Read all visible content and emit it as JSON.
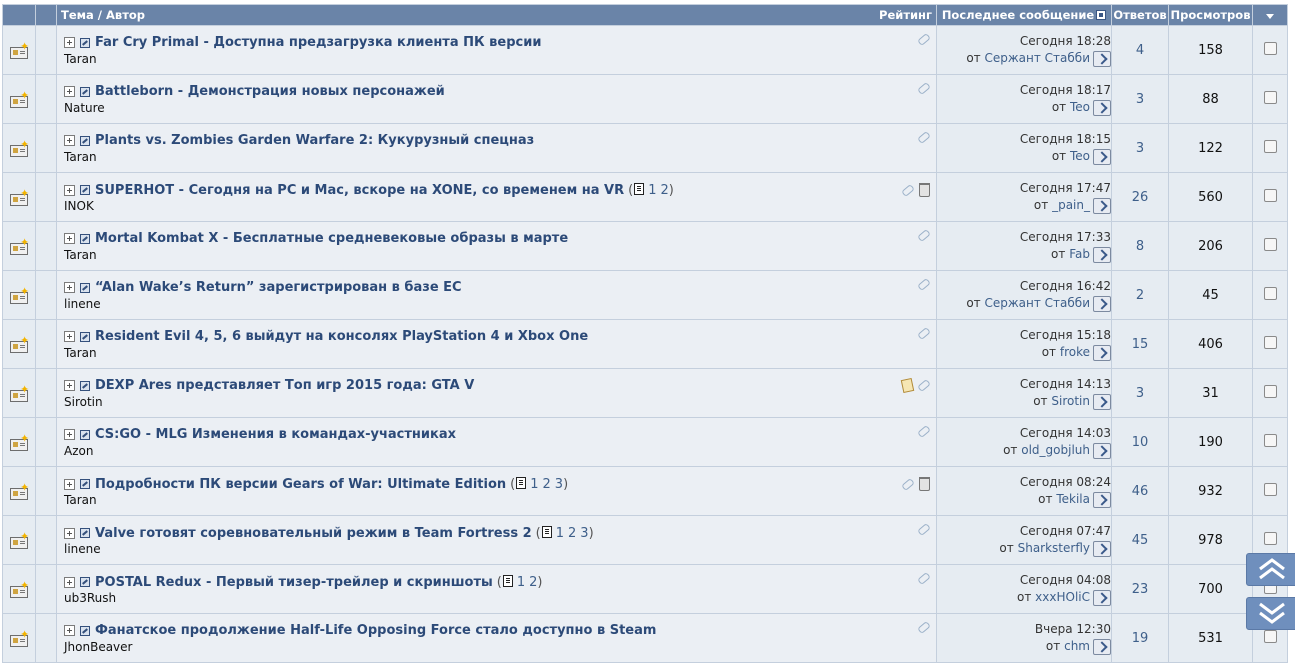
{
  "header": {
    "title_author": "Тема / Автор",
    "rating": "Рейтинг",
    "last_post": "Последнее сообщение",
    "replies": "Ответов",
    "views": "Просмотров"
  },
  "threads": [
    {
      "title": "Far Cry Primal - Доступна предзагрузка клиента ПК версии",
      "author": "Taran",
      "last_date": "Сегодня 18:28",
      "last_from": "от",
      "last_user": "Сержант Стабби",
      "replies": "4",
      "views": "158",
      "pages": [],
      "icons": [
        "paperclip-icon"
      ]
    },
    {
      "title": "Battleborn - Демонстрация новых персонажей",
      "author": "Nature",
      "last_date": "Сегодня 18:17",
      "last_from": "от",
      "last_user": "Teo",
      "replies": "3",
      "views": "88",
      "pages": [],
      "icons": [
        "paperclip-icon"
      ]
    },
    {
      "title": "Plants vs. Zombies Garden Warfare 2: Кукурузный спецназ",
      "author": "Taran",
      "last_date": "Сегодня 18:15",
      "last_from": "от",
      "last_user": "Teo",
      "replies": "3",
      "views": "122",
      "pages": [],
      "icons": [
        "paperclip-icon"
      ]
    },
    {
      "title": "SUPERHOT - Сегодня на PC и Mac, вскоре на XONE, со временем на VR",
      "author": "INOK",
      "last_date": "Сегодня 17:47",
      "last_from": "от",
      "last_user": "_pain_",
      "replies": "26",
      "views": "560",
      "pages": [
        "1",
        "2"
      ],
      "icons": [
        "paperclip-icon",
        "trash-icon"
      ]
    },
    {
      "title": "Mortal Kombat X - Бесплатные средневековые образы в марте",
      "author": "Taran",
      "last_date": "Сегодня 17:33",
      "last_from": "от",
      "last_user": "Fab",
      "replies": "8",
      "views": "206",
      "pages": [],
      "icons": [
        "paperclip-icon"
      ]
    },
    {
      "title": "“Alan Wake’s Return” зарегистрирован в базе ЕС",
      "author": "linene",
      "last_date": "Сегодня 16:42",
      "last_from": "от",
      "last_user": "Сержант Стабби",
      "replies": "2",
      "views": "45",
      "pages": [],
      "icons": [
        "paperclip-icon"
      ]
    },
    {
      "title": "Resident Evil 4, 5, 6 выйдут на консолях PlayStation 4 и Xbox One",
      "author": "Taran",
      "last_date": "Сегодня 15:18",
      "last_from": "от",
      "last_user": "froke",
      "replies": "15",
      "views": "406",
      "pages": [],
      "icons": [
        "paperclip-icon"
      ]
    },
    {
      "title": "DEXP Ares представляет Топ игр 2015 года: GTA V",
      "author": "Sirotin",
      "last_date": "Сегодня 14:13",
      "last_from": "от",
      "last_user": "Sirotin",
      "replies": "3",
      "views": "31",
      "pages": [],
      "icons": [
        "note-icon",
        "paperclip-icon"
      ]
    },
    {
      "title": "CS:GO - MLG Изменения в командах-участниках",
      "author": "Azon",
      "last_date": "Сегодня 14:03",
      "last_from": "от",
      "last_user": "old_gobjluh",
      "replies": "10",
      "views": "190",
      "pages": [],
      "icons": [
        "paperclip-icon"
      ]
    },
    {
      "title": "Подробности ПК версии Gears of War: Ultimate Edition",
      "author": "Taran",
      "last_date": "Сегодня 08:24",
      "last_from": "от",
      "last_user": "Tekila",
      "replies": "46",
      "views": "932",
      "pages": [
        "1",
        "2",
        "3"
      ],
      "icons": [
        "paperclip-icon",
        "trash-icon"
      ]
    },
    {
      "title": "Valve готовят соревновательный режим в Team Fortress 2",
      "author": "linene",
      "last_date": "Сегодня 07:47",
      "last_from": "от",
      "last_user": "Sharksterfly",
      "replies": "45",
      "views": "978",
      "pages": [
        "1",
        "2",
        "3"
      ],
      "icons": [
        "paperclip-icon"
      ]
    },
    {
      "title": "POSTAL Redux - Первый тизер-трейлер и скриншоты",
      "author": "ub3Rush",
      "last_date": "Сегодня 04:08",
      "last_from": "от",
      "last_user": "xxxHOliC",
      "replies": "23",
      "views": "700",
      "pages": [
        "1",
        "2"
      ],
      "icons": [
        "paperclip-icon"
      ]
    },
    {
      "title": "Фанатское продолжение Half-Life Opposing Force стало доступно в Steam",
      "author": "JhonBeaver",
      "last_date": "Вчера 12:30",
      "last_from": "от",
      "last_user": "chm",
      "replies": "19",
      "views": "531",
      "pages": [],
      "icons": [
        "paperclip-icon"
      ]
    }
  ]
}
